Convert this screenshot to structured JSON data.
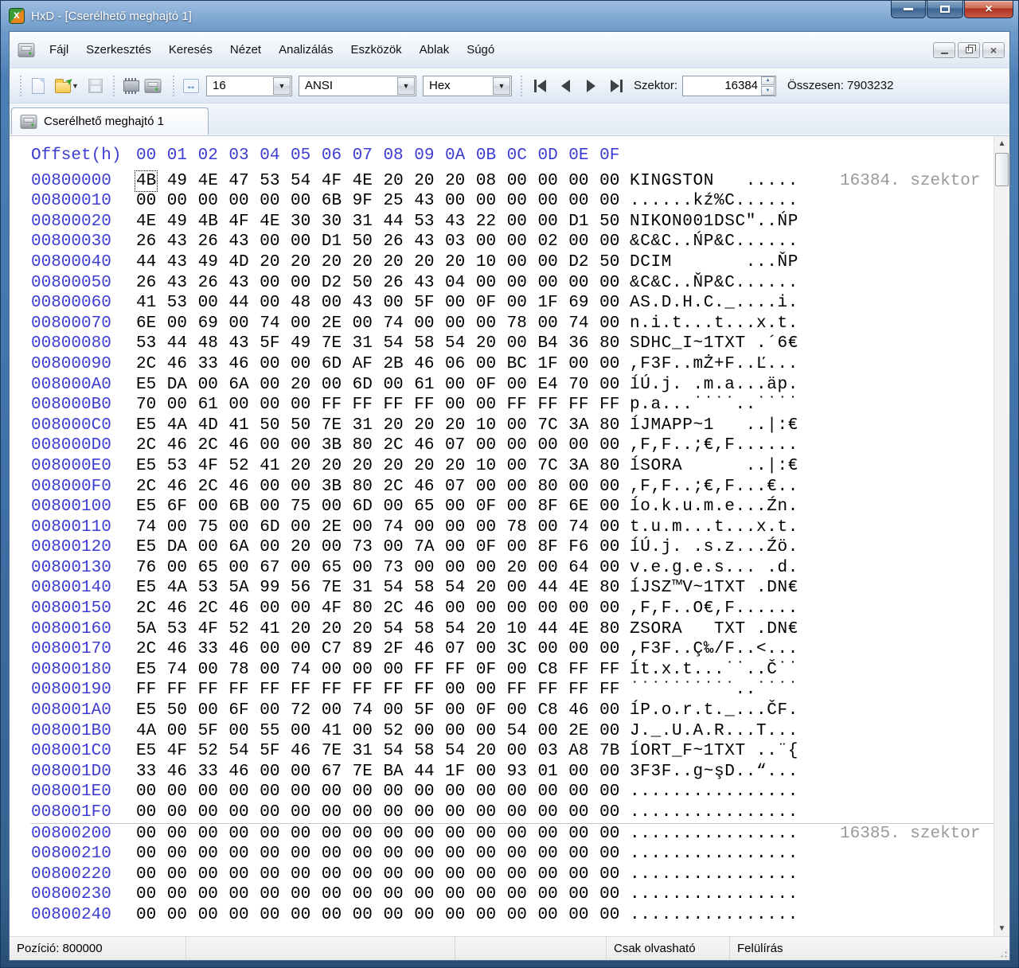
{
  "window": {
    "title": "HxD - [Cserélhető meghajtó 1]"
  },
  "menu": {
    "items": [
      "Fájl",
      "Szerkesztés",
      "Keresés",
      "Nézet",
      "Analizálás",
      "Eszközök",
      "Ablak",
      "Súgó"
    ]
  },
  "toolbar": {
    "bytes_per_row": "16",
    "encoding": "ANSI",
    "offset_base": "Hex",
    "sector_label": "Szektor:",
    "sector_value": "16384",
    "total_label": "Összesen: 7903232"
  },
  "tab": {
    "label": "Cserélhető meghajtó 1"
  },
  "hex_view": {
    "header_offset": "Offset(h)",
    "header_cols": "00 01 02 03 04 05 06 07 08 09 0A 0B 0C 0D 0E 0F",
    "rows": [
      {
        "offset": "00800000",
        "bytes": "4B 49 4E 47 53 54 4F 4E 20 20 20 08 00 00 00 00",
        "ascii": "KINGSTON   .....",
        "note": "16384. szektor",
        "caret": true
      },
      {
        "offset": "00800010",
        "bytes": "00 00 00 00 00 00 6B 9F 25 43 00 00 00 00 00 00",
        "ascii": "......kź%C......"
      },
      {
        "offset": "00800020",
        "bytes": "4E 49 4B 4F 4E 30 30 31 44 53 43 22 00 00 D1 50",
        "ascii": "NIKON001DSC\"..ŃP"
      },
      {
        "offset": "00800030",
        "bytes": "26 43 26 43 00 00 D1 50 26 43 03 00 00 02 00 00",
        "ascii": "&C&C..ŃP&C......"
      },
      {
        "offset": "00800040",
        "bytes": "44 43 49 4D 20 20 20 20 20 20 20 10 00 00 D2 50",
        "ascii": "DCIM       ...ŇP"
      },
      {
        "offset": "00800050",
        "bytes": "26 43 26 43 00 00 D2 50 26 43 04 00 00 00 00 00",
        "ascii": "&C&C..ŇP&C......"
      },
      {
        "offset": "00800060",
        "bytes": "41 53 00 44 00 48 00 43 00 5F 00 0F 00 1F 69 00",
        "ascii": "AS.D.H.C._....i."
      },
      {
        "offset": "00800070",
        "bytes": "6E 00 69 00 74 00 2E 00 74 00 00 00 78 00 74 00",
        "ascii": "n.i.t...t...x.t."
      },
      {
        "offset": "00800080",
        "bytes": "53 44 48 43 5F 49 7E 31 54 58 54 20 00 B4 36 80",
        "ascii": "SDHC_I~1TXT .´6€"
      },
      {
        "offset": "00800090",
        "bytes": "2C 46 33 46 00 00 6D AF 2B 46 06 00 BC 1F 00 00",
        "ascii": ",F3F..mŻ+F..Ľ..."
      },
      {
        "offset": "008000A0",
        "bytes": "E5 DA 00 6A 00 20 00 6D 00 61 00 0F 00 E4 70 00",
        "ascii": "ĺÚ.j. .m.a...äp."
      },
      {
        "offset": "008000B0",
        "bytes": "70 00 61 00 00 00 FF FF FF FF 00 00 FF FF FF FF",
        "ascii": "p.a...˙˙˙˙..˙˙˙˙"
      },
      {
        "offset": "008000C0",
        "bytes": "E5 4A 4D 41 50 50 7E 31 20 20 20 10 00 7C 3A 80",
        "ascii": "ĺJMAPP~1   ..|:€"
      },
      {
        "offset": "008000D0",
        "bytes": "2C 46 2C 46 00 00 3B 80 2C 46 07 00 00 00 00 00",
        "ascii": ",F,F..;€,F......"
      },
      {
        "offset": "008000E0",
        "bytes": "E5 53 4F 52 41 20 20 20 20 20 20 10 00 7C 3A 80",
        "ascii": "ĺSORA      ..|:€"
      },
      {
        "offset": "008000F0",
        "bytes": "2C 46 2C 46 00 00 3B 80 2C 46 07 00 00 80 00 00",
        "ascii": ",F,F..;€,F...€.."
      },
      {
        "offset": "00800100",
        "bytes": "E5 6F 00 6B 00 75 00 6D 00 65 00 0F 00 8F 6E 00",
        "ascii": "ĺo.k.u.m.e...Źn."
      },
      {
        "offset": "00800110",
        "bytes": "74 00 75 00 6D 00 2E 00 74 00 00 00 78 00 74 00",
        "ascii": "t.u.m...t...x.t."
      },
      {
        "offset": "00800120",
        "bytes": "E5 DA 00 6A 00 20 00 73 00 7A 00 0F 00 8F F6 00",
        "ascii": "ĺÚ.j. .s.z...Źö."
      },
      {
        "offset": "00800130",
        "bytes": "76 00 65 00 67 00 65 00 73 00 00 00 20 00 64 00",
        "ascii": "v.e.g.e.s... .d."
      },
      {
        "offset": "00800140",
        "bytes": "E5 4A 53 5A 99 56 7E 31 54 58 54 20 00 44 4E 80",
        "ascii": "ĺJSZ™V~1TXT .DN€"
      },
      {
        "offset": "00800150",
        "bytes": "2C 46 2C 46 00 00 4F 80 2C 46 00 00 00 00 00 00",
        "ascii": ",F,F..O€,F......"
      },
      {
        "offset": "00800160",
        "bytes": "5A 53 4F 52 41 20 20 20 54 58 54 20 10 44 4E 80",
        "ascii": "ZSORA   TXT .DN€"
      },
      {
        "offset": "00800170",
        "bytes": "2C 46 33 46 00 00 C7 89 2F 46 07 00 3C 00 00 00",
        "ascii": ",F3F..Ç‰/F..<..."
      },
      {
        "offset": "00800180",
        "bytes": "E5 74 00 78 00 74 00 00 00 FF FF 0F 00 C8 FF FF",
        "ascii": "ĺt.x.t...˙˙..Č˙˙"
      },
      {
        "offset": "00800190",
        "bytes": "FF FF FF FF FF FF FF FF FF FF 00 00 FF FF FF FF",
        "ascii": "˙˙˙˙˙˙˙˙˙˙..˙˙˙˙"
      },
      {
        "offset": "008001A0",
        "bytes": "E5 50 00 6F 00 72 00 74 00 5F 00 0F 00 C8 46 00",
        "ascii": "ĺP.o.r.t._...ČF."
      },
      {
        "offset": "008001B0",
        "bytes": "4A 00 5F 00 55 00 41 00 52 00 00 00 54 00 2E 00",
        "ascii": "J._.U.A.R...T..."
      },
      {
        "offset": "008001C0",
        "bytes": "E5 4F 52 54 5F 46 7E 31 54 58 54 20 00 03 A8 7B",
        "ascii": "ĺORT_F~1TXT ..¨{"
      },
      {
        "offset": "008001D0",
        "bytes": "33 46 33 46 00 00 67 7E BA 44 1F 00 93 01 00 00",
        "ascii": "3F3F..g~şD..“..."
      },
      {
        "offset": "008001E0",
        "bytes": "00 00 00 00 00 00 00 00 00 00 00 00 00 00 00 00",
        "ascii": "................"
      },
      {
        "offset": "008001F0",
        "bytes": "00 00 00 00 00 00 00 00 00 00 00 00 00 00 00 00",
        "ascii": "................"
      },
      {
        "offset": "00800200",
        "bytes": "00 00 00 00 00 00 00 00 00 00 00 00 00 00 00 00",
        "ascii": "................",
        "note": "16385. szektor",
        "sector_line": true
      },
      {
        "offset": "00800210",
        "bytes": "00 00 00 00 00 00 00 00 00 00 00 00 00 00 00 00",
        "ascii": "................"
      },
      {
        "offset": "00800220",
        "bytes": "00 00 00 00 00 00 00 00 00 00 00 00 00 00 00 00",
        "ascii": "................"
      },
      {
        "offset": "00800230",
        "bytes": "00 00 00 00 00 00 00 00 00 00 00 00 00 00 00 00",
        "ascii": "................"
      },
      {
        "offset": "00800240",
        "bytes": "00 00 00 00 00 00 00 00 00 00 00 00 00 00 00 00",
        "ascii": "................"
      }
    ]
  },
  "status_bar": {
    "position": "Pozíció: 800000",
    "read_only": "Csak olvasható",
    "write_mode": "Felülírás"
  }
}
